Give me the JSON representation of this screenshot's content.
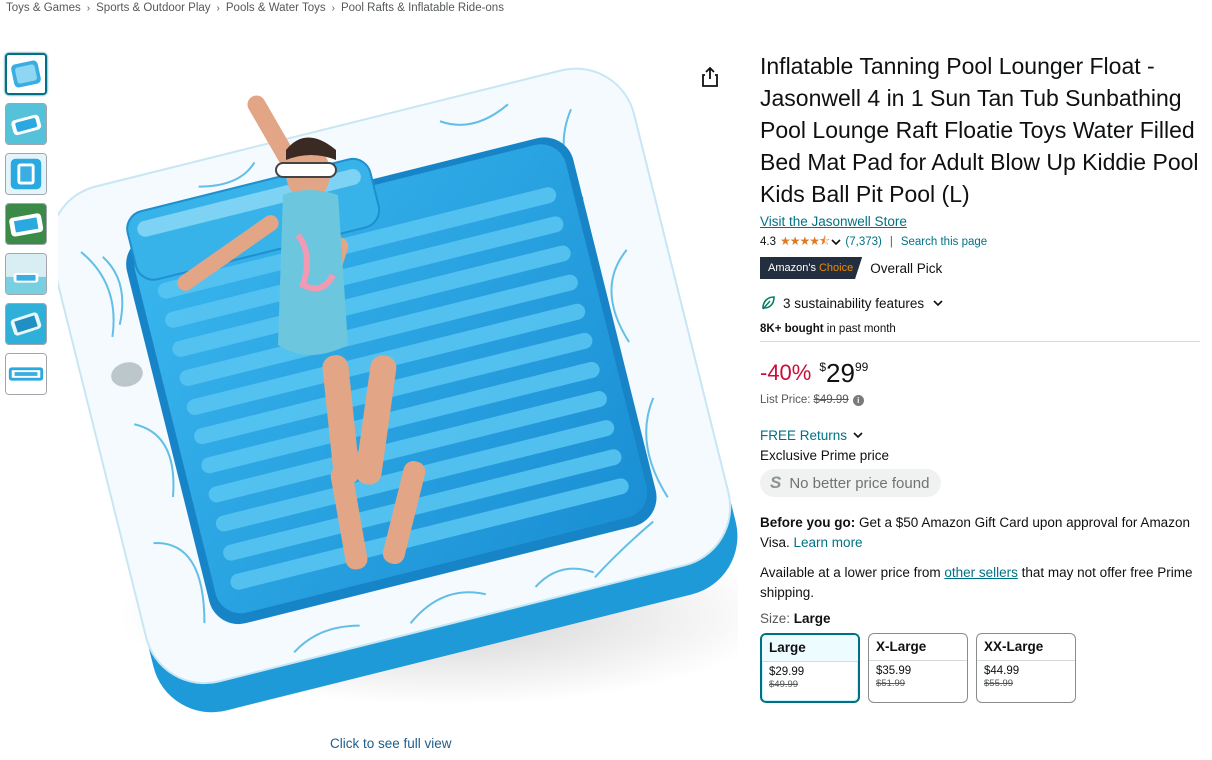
{
  "breadcrumb": [
    "Toys & Games",
    "Sports & Outdoor Play",
    "Pools & Water Toys",
    "Pool Rafts & Inflatable Ride-ons"
  ],
  "breadcrumb_separator": "›",
  "image": {
    "full_view_label": "Click to see full view"
  },
  "product": {
    "title": "Inflatable Tanning Pool Lounger Float - Jasonwell 4 in 1 Sun Tan Tub Sunbathing Pool Lounge Raft Floatie Toys Water Filled Bed Mat Pad for Adult Blow Up Kiddie Pool Kids Ball Pit Pool (L)",
    "store_link": "Visit the Jasonwell Store",
    "rating": "4.3",
    "rating_value": 4.3,
    "stars_glyph": "★★★★⯪",
    "rating_count": "(7,373)",
    "rating_separator": "|",
    "search_page": "Search this page",
    "badge_prefix": "Amazon's",
    "badge_highlight": "Choice",
    "overall_pick": "Overall Pick",
    "sustainability": "3 sustainability features",
    "bought_bold": "8K+ bought",
    "bought_rest": " in past month",
    "discount": "-40%",
    "price_symbol": "$",
    "price_whole": "29",
    "price_fraction": "99",
    "list_price_label": "List Price:",
    "list_price": "$49.99",
    "free_returns": "FREE Returns",
    "exclusive_prime": "Exclusive Prime price",
    "no_better_icon": "S",
    "no_better": "No better price found",
    "before_go_bold": "Before you go:",
    "before_go_text": " Get a $50 Amazon Gift Card upon approval for Amazon Visa. ",
    "learn_more": "Learn more",
    "lower_price_a": "Available at a lower price from ",
    "other_sellers": "other sellers",
    "lower_price_b": " that may not offer free Prime shipping.",
    "size_label": "Size: ",
    "size_selected": "Large",
    "sizes": [
      {
        "name": "Large",
        "price": "$29.99",
        "list": "$49.99"
      },
      {
        "name": "X-Large",
        "price": "$35.99",
        "list": "$51.99"
      },
      {
        "name": "XX-Large",
        "price": "$44.99",
        "list": "$55.99"
      }
    ]
  },
  "colors": {
    "link": "#007185",
    "discount": "#cc0c39",
    "star": "#de7921",
    "badge_bg": "#232f3e",
    "badge_accent": "#f08804",
    "float_blue": "#2aa8e0"
  },
  "icons": {
    "share": "share-icon",
    "leaf": "leaf-icon",
    "chevron": "chevron-down-icon",
    "info": "info-icon"
  }
}
